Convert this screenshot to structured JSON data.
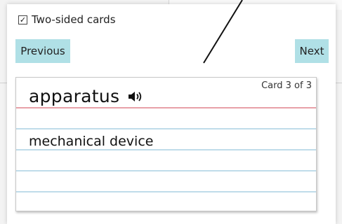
{
  "options": {
    "two_sided_checked": true,
    "two_sided_checkmark": "☑",
    "two_sided_label": "Two-sided cards"
  },
  "nav": {
    "previous_label": "Previous",
    "next_label": "Next"
  },
  "card": {
    "counter": "Card 3 of 3",
    "term": "apparatus",
    "definition": "mechanical device",
    "audio_icon": "speaker-icon"
  },
  "colors": {
    "button_bg": "#b0e0e6",
    "rule_line": "#bfdcea",
    "margin_line": "#e8a0a8"
  }
}
